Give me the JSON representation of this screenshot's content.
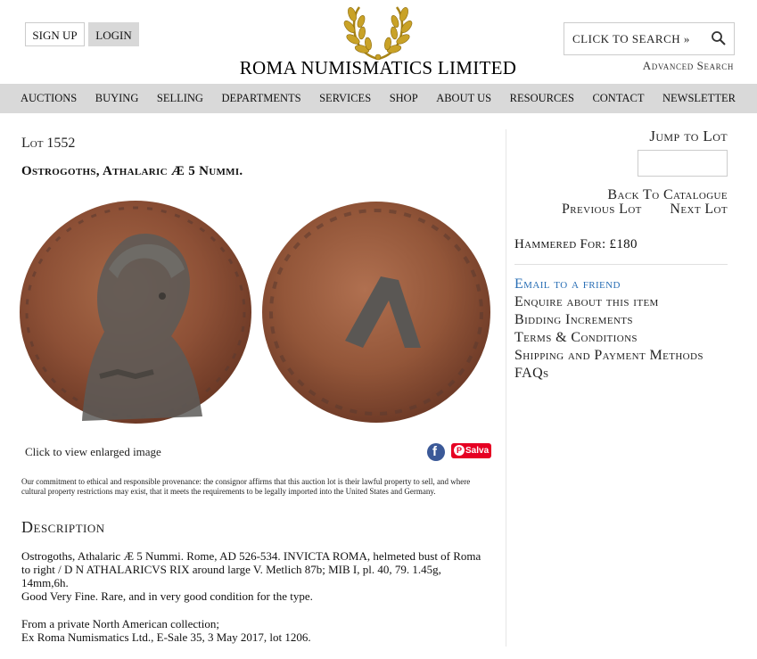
{
  "header": {
    "signup_label": "SIGN UP",
    "login_label": "LOGIN",
    "logo_text": "ROMA NUMISMATICS LIMITED",
    "search_placeholder": "CLICK TO SEARCH »",
    "advanced_search": "Advanced Search"
  },
  "nav": {
    "items": [
      "AUCTIONS",
      "BUYING",
      "SELLING",
      "DEPARTMENTS",
      "SERVICES",
      "SHOP",
      "ABOUT US",
      "RESOURCES",
      "CONTACT",
      "NEWSLETTER"
    ]
  },
  "lot": {
    "number": "Lot 1552",
    "title": "Ostrogoths, Athalaric Æ 5 Nummi.",
    "image_caption": "Click to view enlarged image",
    "save_label": "Salva",
    "provenance": "Our commitment to ethical and responsible provenance: the consignor affirms that this auction lot is their lawful property to sell, and where cultural property restrictions may exist, that it meets the requirements to be legally imported into the United States and Germany.",
    "description_heading": "Description",
    "description": [
      "Ostrogoths, Athalaric Æ 5 Nummi. Rome, AD 526-534. INVICTA ROMA, helmeted bust of Roma to right / D N ATHALARICVS RIX around large V. Metlich 87b; MIB I, pl. 40, 79. 1.45g, 14mm,6h.",
      "Good Very Fine. Rare, and in very good condition for the type.",
      "From a private North American collection;",
      "Ex Roma Numismatics Ltd., E-Sale 35, 3 May 2017, lot 1206."
    ]
  },
  "sidebar": {
    "jump_to_lot": "Jump to Lot",
    "back_to_catalogue": "Back To Catalogue",
    "previous_lot": "Previous Lot",
    "next_lot": "Next Lot",
    "hammered_for": "Hammered For: £180",
    "links": [
      "Email to a friend",
      "Enquire about this item",
      "Bidding Increments",
      "Terms & Conditions",
      "Shipping and Payment Methods",
      "FAQs"
    ]
  },
  "colors": {
    "nav_bg": "#d9d9d9",
    "link_active": "#2a6fb5",
    "gold": "#c9a227",
    "coin_copper": "#9a5a3c"
  }
}
